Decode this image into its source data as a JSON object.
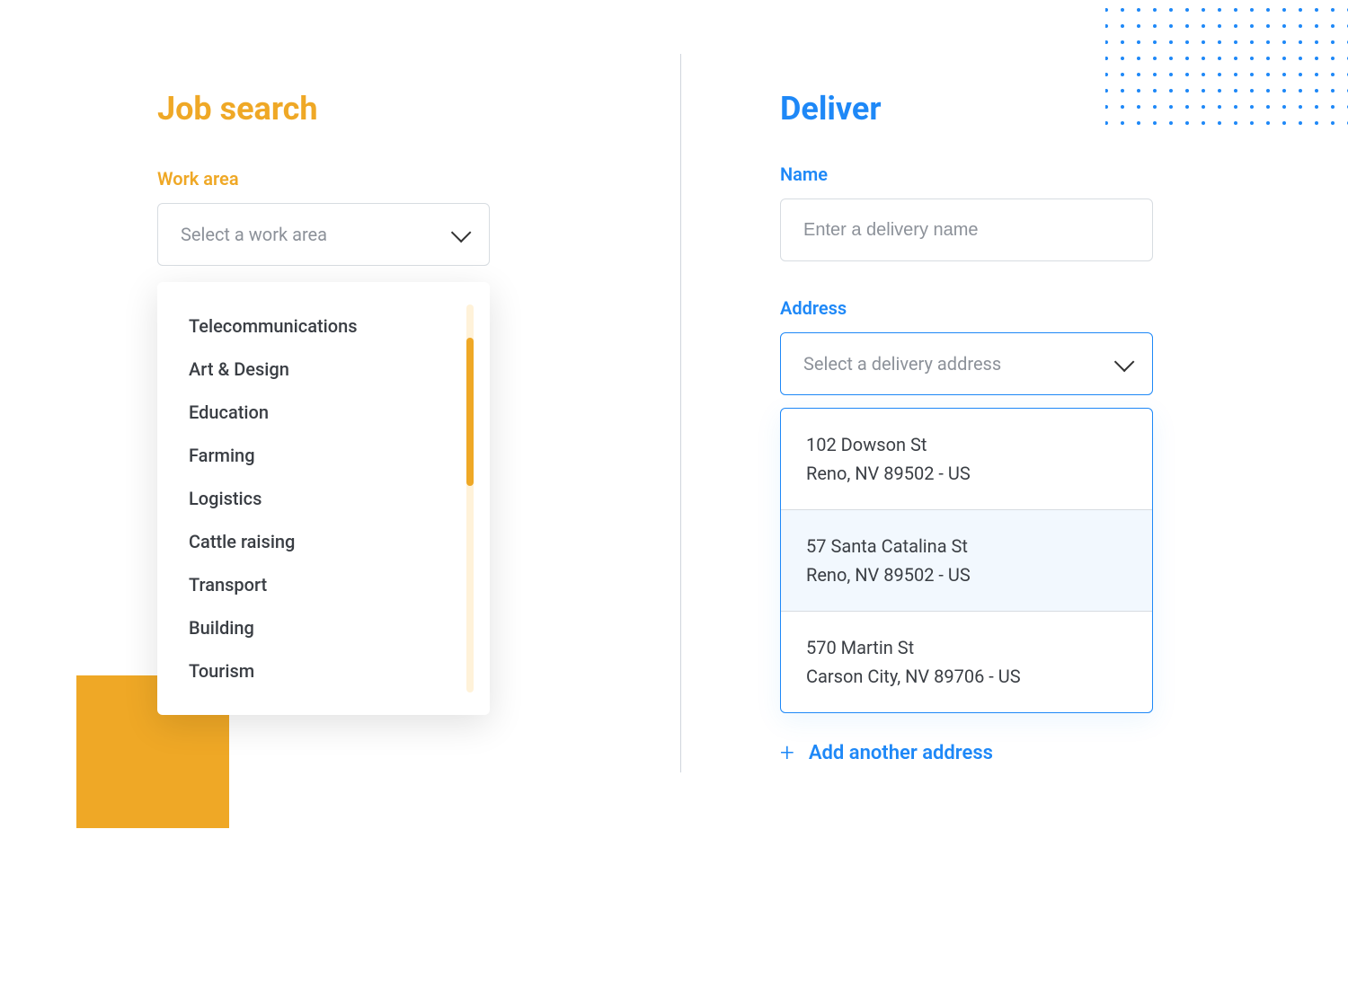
{
  "left": {
    "title": "Job search",
    "workArea": {
      "label": "Work area",
      "placeholder": "Select a work area",
      "options": [
        "Telecommunications",
        "Art & Design",
        "Education",
        "Farming",
        "Logistics",
        "Cattle raising",
        "Transport",
        "Building",
        "Tourism"
      ]
    }
  },
  "right": {
    "title": "Deliver",
    "name": {
      "label": "Name",
      "placeholder": "Enter a delivery name"
    },
    "address": {
      "label": "Address",
      "placeholder": "Select a delivery address",
      "items": [
        {
          "line1": "102 Dowson St",
          "line2": "Reno, NV 89502 - US",
          "highlighted": false
        },
        {
          "line1": "57 Santa Catalina St",
          "line2": "Reno, NV 89502 - US",
          "highlighted": true
        },
        {
          "line1": "570 Martin St",
          "line2": "Carson City, NV 89706 - US",
          "highlighted": false
        }
      ],
      "addLink": "Add another address"
    }
  }
}
